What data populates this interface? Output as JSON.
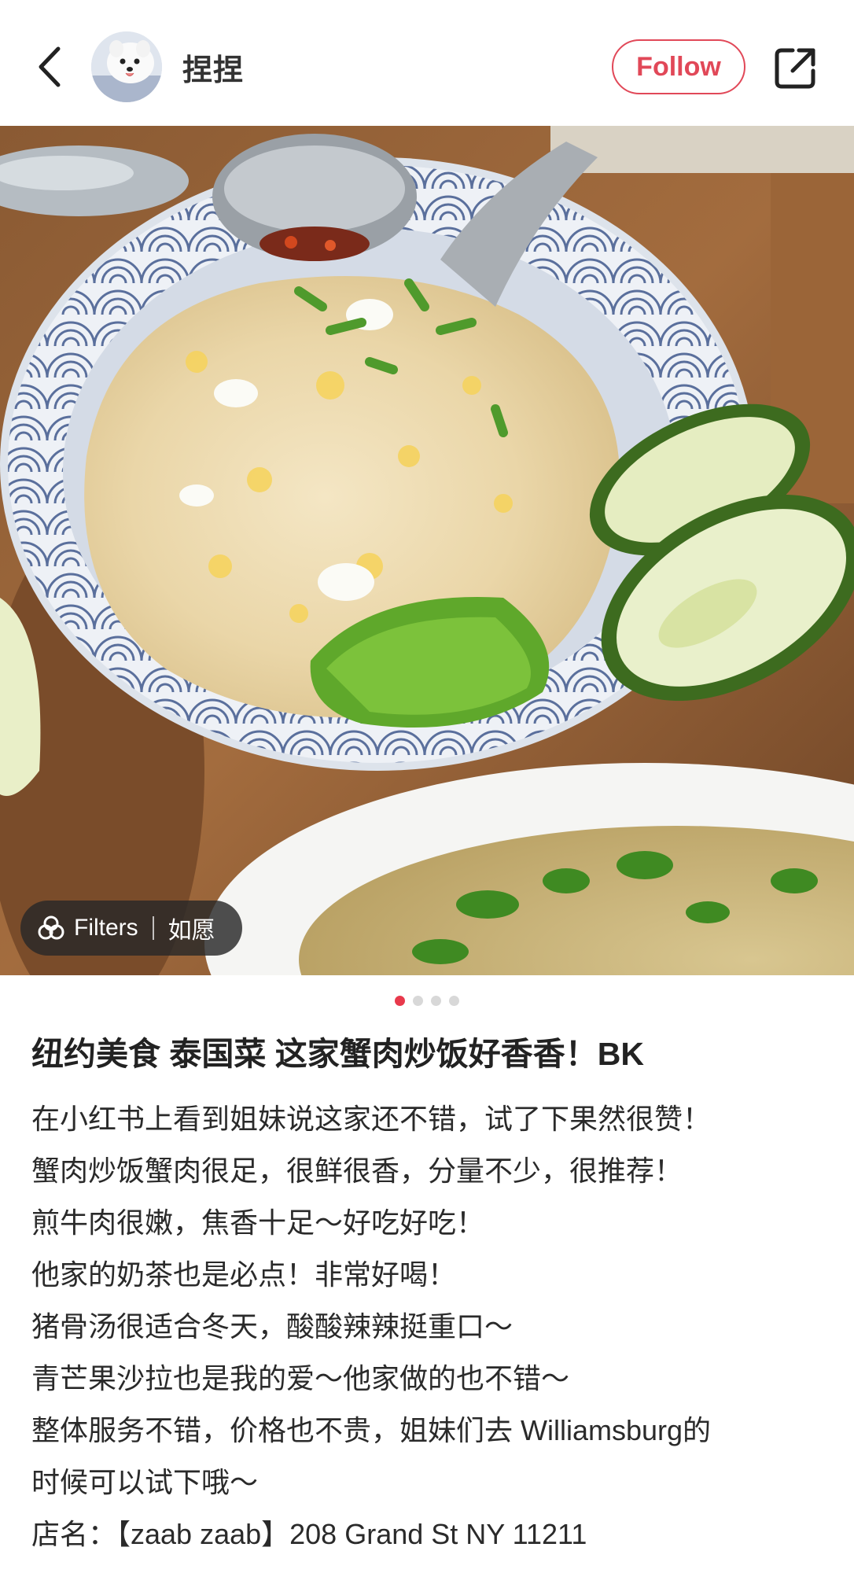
{
  "header": {
    "username": "捏捏",
    "follow_label": "Follow"
  },
  "icons": {
    "back": "chevron-left-icon",
    "share": "share-external-icon",
    "filters": "filters-icon"
  },
  "image_overlay": {
    "filters_label": "Filters",
    "filter_name": "如愿"
  },
  "carousel": {
    "total": 4,
    "current": 1
  },
  "post": {
    "title": "纽约美食 泰国菜 这家蟹肉炒饭好香香！BK",
    "lines": [
      "在小红书上看到姐妹说这家还不错，试了下果然很赞！",
      "蟹肉炒饭蟹肉很足，很鲜很香，分量不少，很推荐！",
      "煎牛肉很嫩，焦香十足～好吃好吃！",
      "他家的奶茶也是必点！非常好喝！",
      "猪骨汤很适合冬天，酸酸辣辣挺重口～",
      "青芒果沙拉也是我的爱～他家做的也不错～",
      "整体服务不错，价格也不贵，姐妹们去 Williamsburg的",
      "时候可以试下哦～",
      "店名：【zaab zaab】208 Grand St NY 11211"
    ]
  },
  "colors": {
    "accent": "#e14858",
    "dot_active": "#e8394c",
    "dot_inactive": "#d8d8d8"
  }
}
